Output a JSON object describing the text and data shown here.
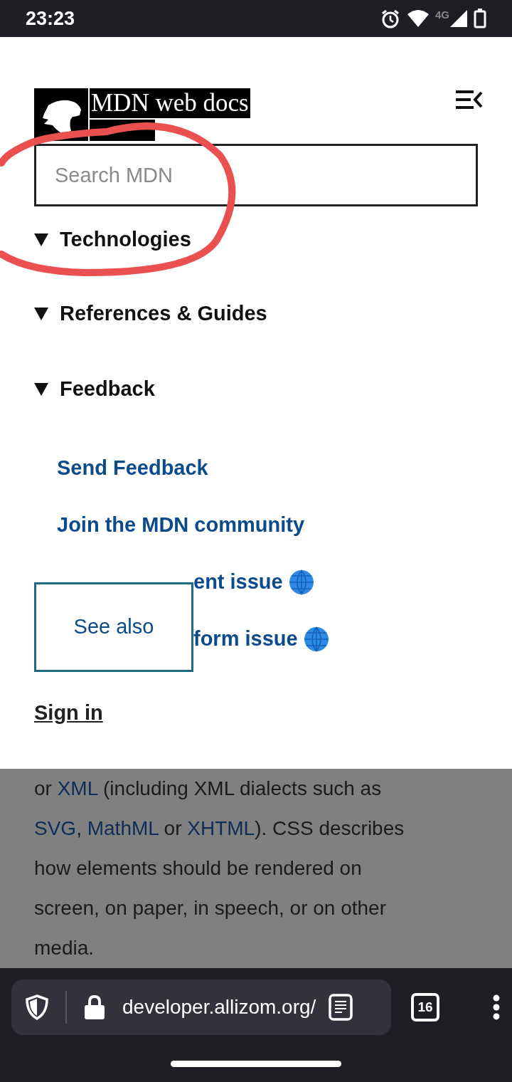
{
  "status_bar": {
    "time": "23:23",
    "network": "4G"
  },
  "header": {
    "logo_text": "MDN web docs"
  },
  "search": {
    "placeholder": "Search MDN"
  },
  "sections": [
    {
      "label": "Technologies",
      "expanded": true
    },
    {
      "label": "References & Guides",
      "expanded": true
    },
    {
      "label": "Feedback",
      "expanded": true
    }
  ],
  "links": [
    {
      "label": "Send Feedback",
      "kind": "full",
      "globe": false
    },
    {
      "label": "Join the MDN community",
      "kind": "full",
      "globe": false
    },
    {
      "label": "ent issue",
      "kind": "partial",
      "globe": true
    },
    {
      "label": "form issue",
      "kind": "partial",
      "globe": true
    }
  ],
  "see_also": "See also",
  "sign_in": "Sign in",
  "article": [
    [
      {
        "text": "or ",
        "link": false
      },
      {
        "text": "XML",
        "link": true
      },
      {
        "text": " (including XML dialects such as",
        "link": false
      }
    ],
    [
      {
        "text": "SVG",
        "link": true
      },
      {
        "text": ", ",
        "link": false
      },
      {
        "text": "MathML",
        "link": true
      },
      {
        "text": " or ",
        "link": false
      },
      {
        "text": "XHTML",
        "link": true
      },
      {
        "text": "). CSS describes",
        "link": false
      }
    ],
    [
      {
        "text": "how elements should be rendered on",
        "link": false
      }
    ],
    [
      {
        "text": "screen, on paper, in speech, or on other",
        "link": false
      }
    ],
    [
      {
        "text": "media.",
        "link": false
      }
    ]
  ],
  "browser": {
    "url": "developer.allizom.org/",
    "tab_count": "16"
  }
}
